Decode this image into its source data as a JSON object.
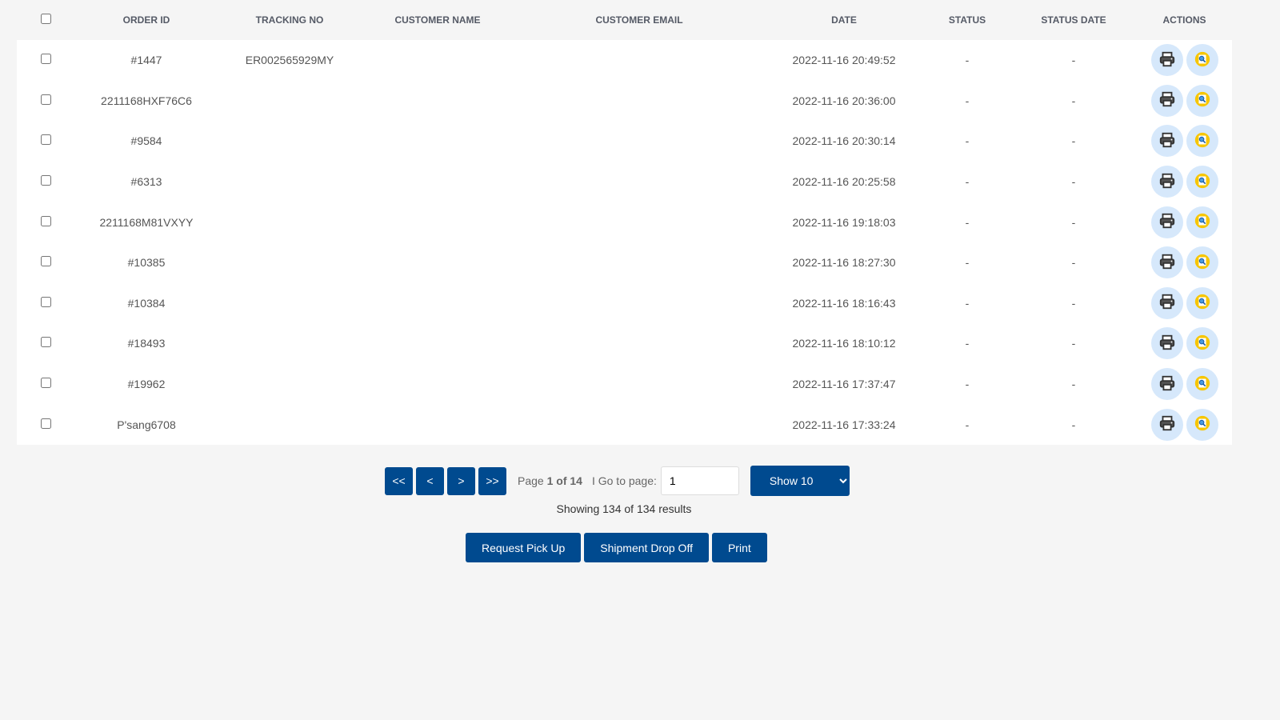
{
  "table": {
    "headers": [
      "Order ID",
      "Tracking No",
      "Customer Name",
      "Customer Email",
      "Date",
      "Status",
      "Status Date",
      "Actions"
    ],
    "rows": [
      {
        "order_id": "#1447",
        "tracking": "ER002565929MY",
        "name": "",
        "email": "",
        "date": "2022-11-16 20:49:52",
        "status": "-",
        "status_date": "-"
      },
      {
        "order_id": "2211168HXF76C6",
        "tracking": "",
        "name": "",
        "email": "",
        "date": "2022-11-16 20:36:00",
        "status": "-",
        "status_date": "-"
      },
      {
        "order_id": "#9584",
        "tracking": "",
        "name": "",
        "email": "",
        "date": "2022-11-16 20:30:14",
        "status": "-",
        "status_date": "-"
      },
      {
        "order_id": "#6313",
        "tracking": "",
        "name": "",
        "email": "",
        "date": "2022-11-16 20:25:58",
        "status": "-",
        "status_date": "-"
      },
      {
        "order_id": "2211168M81VXYY",
        "tracking": "",
        "name": "",
        "email": "",
        "date": "2022-11-16 19:18:03",
        "status": "-",
        "status_date": "-"
      },
      {
        "order_id": "#10385",
        "tracking": "",
        "name": "",
        "email": "",
        "date": "2022-11-16 18:27:30",
        "status": "-",
        "status_date": "-"
      },
      {
        "order_id": "#10384",
        "tracking": "",
        "name": "",
        "email": "",
        "date": "2022-11-16 18:16:43",
        "status": "-",
        "status_date": "-"
      },
      {
        "order_id": "#18493",
        "tracking": "",
        "name": "",
        "email": "",
        "date": "2022-11-16 18:10:12",
        "status": "-",
        "status_date": "-"
      },
      {
        "order_id": "#19962",
        "tracking": "",
        "name": "",
        "email": "",
        "date": "2022-11-16 17:37:47",
        "status": "-",
        "status_date": "-"
      },
      {
        "order_id": "P'sang6708",
        "tracking": "",
        "name": "",
        "email": "",
        "date": "2022-11-16 17:33:24",
        "status": "-",
        "status_date": "-"
      }
    ],
    "action_icons": [
      "printer-icon",
      "search-document-icon"
    ]
  },
  "pager": {
    "first": "<<",
    "prev": "<",
    "next": ">",
    "last": ">>",
    "page_prefix": "Page",
    "page_current": "1 of 14",
    "goto_label": "I Go to page:",
    "goto_value": "1",
    "show_label": "Show 10",
    "results": "Showing 134 of 134 results"
  },
  "buttons": {
    "pickup": "Request Pick Up",
    "dropoff": "Shipment Drop Off",
    "print": "Print"
  },
  "colors": {
    "primary": "#004a8f",
    "icon_bg": "#d6e8fb",
    "background": "#f5f5f5"
  }
}
